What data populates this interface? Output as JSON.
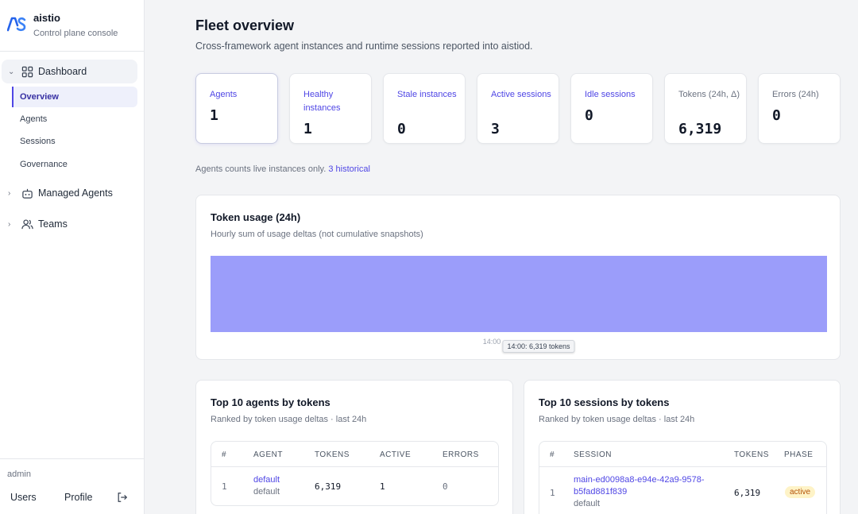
{
  "brand": {
    "name": "aistio",
    "subtitle": "Control plane console",
    "accent": "#4f46e5"
  },
  "sidebar": {
    "dashboard_label": "Dashboard",
    "dashboard_items": [
      "Overview",
      "Agents",
      "Sessions",
      "Governance"
    ],
    "managed_agents_label": "Managed Agents",
    "teams_label": "Teams",
    "user": "admin",
    "users_link": "Users",
    "profile_link": "Profile"
  },
  "page": {
    "title": "Fleet overview",
    "subtitle": "Cross-framework agent instances and runtime sessions reported into aistiod."
  },
  "stats": [
    {
      "label": "Agents",
      "value": "1"
    },
    {
      "label": "Healthy instances",
      "value": "1"
    },
    {
      "label": "Stale instances",
      "value": "0"
    },
    {
      "label": "Active sessions",
      "value": "3"
    },
    {
      "label": "Idle sessions",
      "value": "0"
    },
    {
      "label": "Tokens (24h, Δ)",
      "value": "6,319"
    },
    {
      "label": "Errors (24h)",
      "value": "0"
    }
  ],
  "note": {
    "text": "Agents counts live instances only.",
    "link": "3 historical"
  },
  "token_usage": {
    "title": "Token usage (24h)",
    "subtitle": "Hourly sum of usage deltas (not cumulative snapshots)",
    "tooltip": "14:00: 6,319 tokens"
  },
  "chart_data": {
    "type": "bar",
    "categories": [
      "14:00"
    ],
    "values": [
      6319
    ],
    "title": "Token usage (24h)",
    "xlabel": "",
    "ylabel": "",
    "grid": false,
    "color": "#9b9dfa"
  },
  "top_agents": {
    "title": "Top 10 agents by tokens",
    "subtitle": "Ranked by token usage deltas · last 24h",
    "columns": [
      "#",
      "AGENT",
      "TOKENS",
      "ACTIVE",
      "ERRORS"
    ],
    "rows": [
      {
        "rank": "1",
        "agent": "default",
        "namespace": "default",
        "tokens": "6,319",
        "active": "1",
        "errors": "0"
      }
    ]
  },
  "top_sessions": {
    "title": "Top 10 sessions by tokens",
    "subtitle": "Ranked by token usage deltas · last 24h",
    "columns": [
      "#",
      "SESSION",
      "TOKENS",
      "PHASE"
    ],
    "rows": [
      {
        "rank": "1",
        "session_line1": "main-ed0098a8-e94e-42a9-9578-",
        "session_line2": "b5fad881f839",
        "namespace": "default",
        "tokens": "6,319",
        "phase": "active"
      }
    ]
  }
}
